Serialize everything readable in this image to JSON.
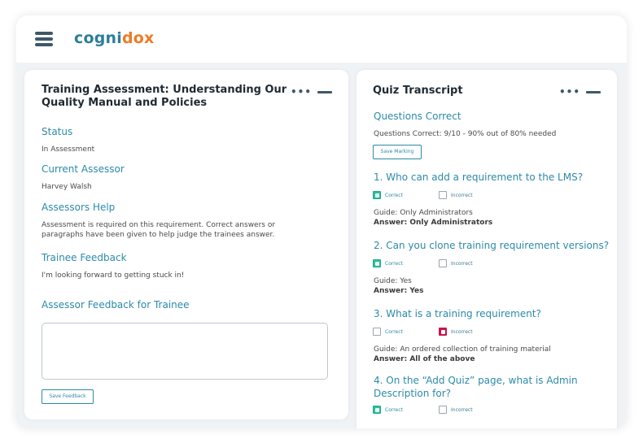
{
  "header": {
    "logo_part1": "cogni",
    "logo_part2": "dox",
    "colors": {
      "brand_teal": "#2c7e9a",
      "brand_orange": "#f07a22",
      "accent": "#2c8aa8"
    }
  },
  "left_card": {
    "title": "Training Assessment: Understanding Our Quality Manual and Policies",
    "menu_dots": "•••",
    "sections": [
      {
        "heading": "Status",
        "text": "In Assessment"
      },
      {
        "heading": "Current Assessor",
        "text": "Harvey Walsh"
      },
      {
        "heading": "Assessors Help",
        "text": "Assessment is required on this requirement. Correct answers or paragraphs have been given to help judge the trainees answer."
      },
      {
        "heading": "Trainee Feedback",
        "text": "I'm looking forward to getting stuck in!"
      }
    ],
    "feedback_heading": "Assessor Feedback for Trainee",
    "feedback_value": "",
    "save_feedback_label": "Save Feedback"
  },
  "right_card": {
    "title": "Quiz Transcript",
    "menu_dots": "•••",
    "score_heading": "Questions Correct",
    "score_text": "Questions Correct: 9/10 - 90% out of 80% needed",
    "save_marking_label": "Save Marking",
    "correct_label": "Correct",
    "incorrect_label": "Incorrect",
    "questions": [
      {
        "question": "1. Who can add a requirement to the LMS?",
        "marked": "correct",
        "guide": "Guide: Only Administrators",
        "answer": "Answer: Only Administrators"
      },
      {
        "question": "2. Can you clone training requirement versions?",
        "marked": "correct",
        "guide": "Guide: Yes",
        "answer": "Answer: Yes"
      },
      {
        "question": "3. What is a training requirement?",
        "marked": "incorrect",
        "guide": "Guide: An ordered collection of training material",
        "answer": "Answer: All of the above"
      },
      {
        "question": "4. On the “Add Quiz” page, what is Admin Description for?",
        "marked": "correct"
      }
    ]
  }
}
